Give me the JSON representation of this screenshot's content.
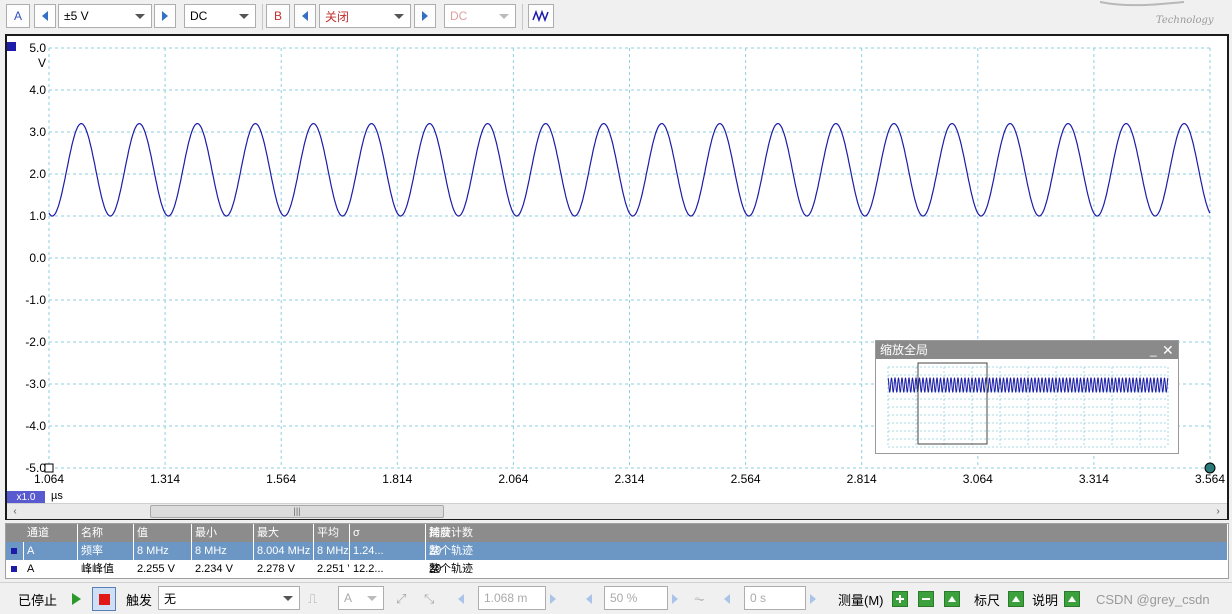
{
  "toolbar": {
    "channel_a": "A",
    "range": "±5 V",
    "coupling_a": "DC",
    "channel_b": "B",
    "range_b": "关闭",
    "coupling_b": "DC",
    "logo_text": "Technology"
  },
  "plot": {
    "y_unit": "V",
    "x_unit": "µs",
    "zoom_badge": "x1.0",
    "overview_title": "缩放全局",
    "colors": {
      "trace": "#1c1ca8",
      "grid": "#8fcfe0",
      "frame": "#1a1a1a"
    }
  },
  "chart_data": {
    "type": "line",
    "xlabel": "µs",
    "ylabel": "V",
    "xlim": [
      1.064,
      3.564
    ],
    "ylim": [
      -5.0,
      5.0
    ],
    "x_ticks": [
      "1.064",
      "1.314",
      "1.564",
      "1.814",
      "2.064",
      "2.314",
      "2.564",
      "2.814",
      "3.064",
      "3.314",
      "3.564"
    ],
    "y_ticks": [
      "5.0",
      "4.0",
      "3.0",
      "2.0",
      "1.0",
      "0.0",
      "-1.0",
      "-2.0",
      "-3.0",
      "-4.0",
      "-5.0"
    ],
    "grid": true,
    "series": [
      {
        "frequency_mhz": 8,
        "offset_v": 2.1,
        "amplitude_v": 1.1
      }
    ]
  },
  "measurements": {
    "headers": [
      "通道",
      "名称",
      "值",
      "最小",
      "最大",
      "平均",
      "σ",
      "捕获计数",
      "跨度"
    ],
    "rows": [
      [
        "A",
        "频率",
        "8 MHz",
        "8 MHz",
        "8.004 MHz",
        "8 MHz",
        "1.24...",
        "20",
        "整个轨迹"
      ],
      [
        "A",
        "峰峰值",
        "2.255 V",
        "2.234 V",
        "2.278 V",
        "2.251 V",
        "12.2...",
        "20",
        "整个轨迹"
      ]
    ]
  },
  "bottombar": {
    "status": "已停止",
    "trigger_label": "触发",
    "trigger_mode": "无",
    "trigger_source": "A",
    "threshold": "1.068 m",
    "pretrigger": "50 %",
    "delay": "0 s",
    "measure_label": "测量(M)",
    "ruler_label": "标尺",
    "notes_label": "说明",
    "watermark": "CSDN @grey_csdn"
  }
}
